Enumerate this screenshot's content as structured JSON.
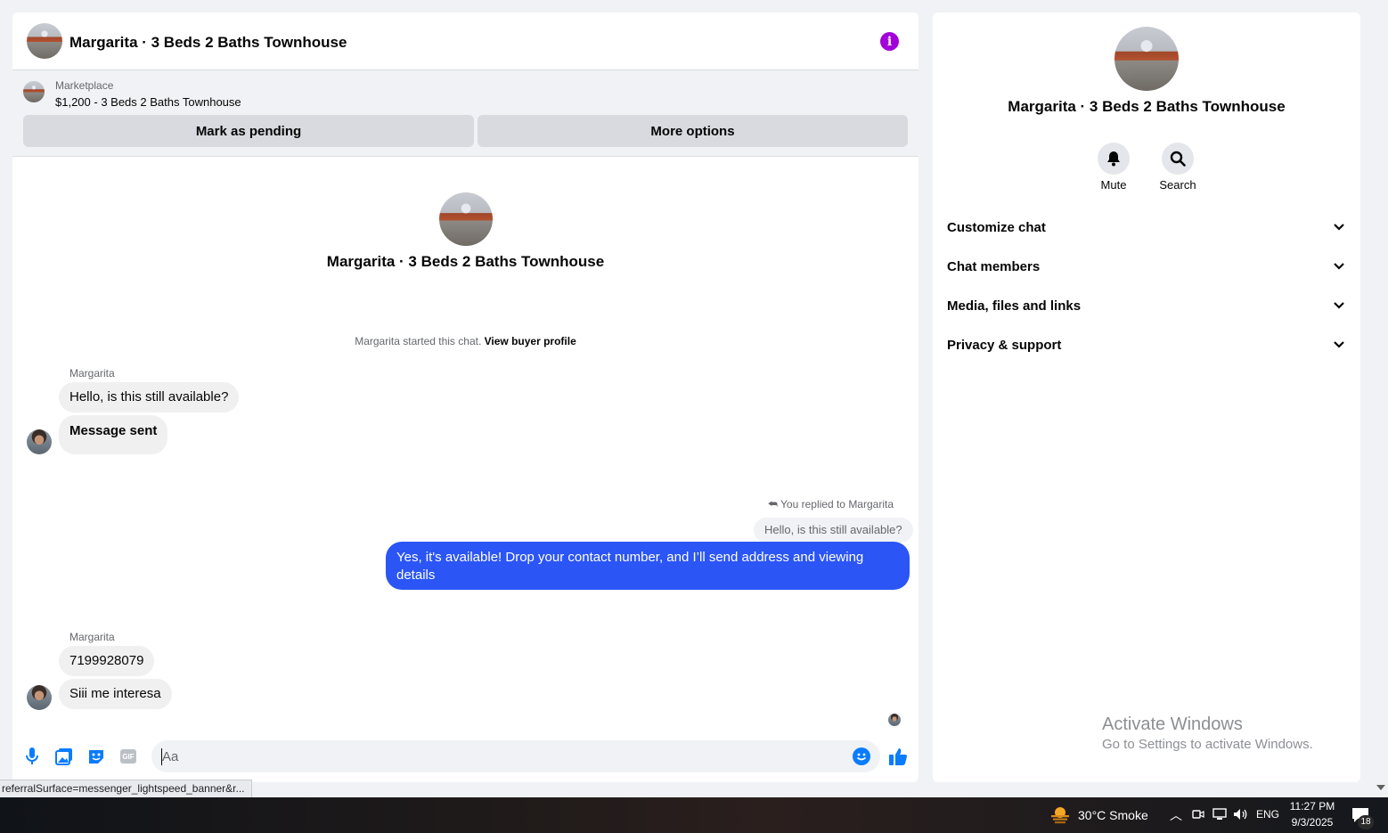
{
  "chat": {
    "title": "Margarita · 3 Beds 2 Baths Townhouse",
    "listing": {
      "kicker": "Marketplace",
      "text": "$1,200 - 3 Beds 2 Baths Townhouse"
    },
    "buttons": {
      "mark_pending": "Mark as pending",
      "more_options": "More options"
    },
    "intro_title": "Margarita · 3 Beds 2 Baths Townhouse",
    "started_text": "Margarita started this chat.",
    "view_profile": "View buyer profile",
    "messages": [
      {
        "sender": "Margarita",
        "text": "Hello, is this still available?"
      },
      {
        "text": "Message sent"
      }
    ],
    "reply": {
      "note": "You replied to Margarita",
      "quote": "Hello, is this still available?",
      "text": "Yes, it's available! Drop your contact number, and I’ll send address and viewing details"
    },
    "messages2": [
      {
        "sender": "Margarita",
        "text": "7199928079"
      },
      {
        "text": "Siii me interesa"
      }
    ],
    "composer_placeholder": "Aa",
    "gif_label": "GIF"
  },
  "info": {
    "title": "Margarita · 3 Beds 2 Baths Townhouse",
    "actions": [
      {
        "label": "Mute",
        "icon": "bell-icon"
      },
      {
        "label": "Search",
        "icon": "search-icon"
      }
    ],
    "sections": [
      "Customize chat",
      "Chat members",
      "Media, files and links",
      "Privacy & support"
    ]
  },
  "watermark": {
    "title": "Activate Windows",
    "sub": "Go to Settings to activate Windows."
  },
  "status_url": "referralSurface=messenger_lightspeed_banner&r...",
  "taskbar": {
    "weather": "30°C  Smoke",
    "language": "ENG",
    "time": "11:27 PM",
    "date": "9/3/2025",
    "notifications": "18"
  },
  "colors": {
    "accent_blue": "#2b55f5",
    "info_purple": "#a300d9",
    "messenger_blue": "#0a7cff"
  }
}
